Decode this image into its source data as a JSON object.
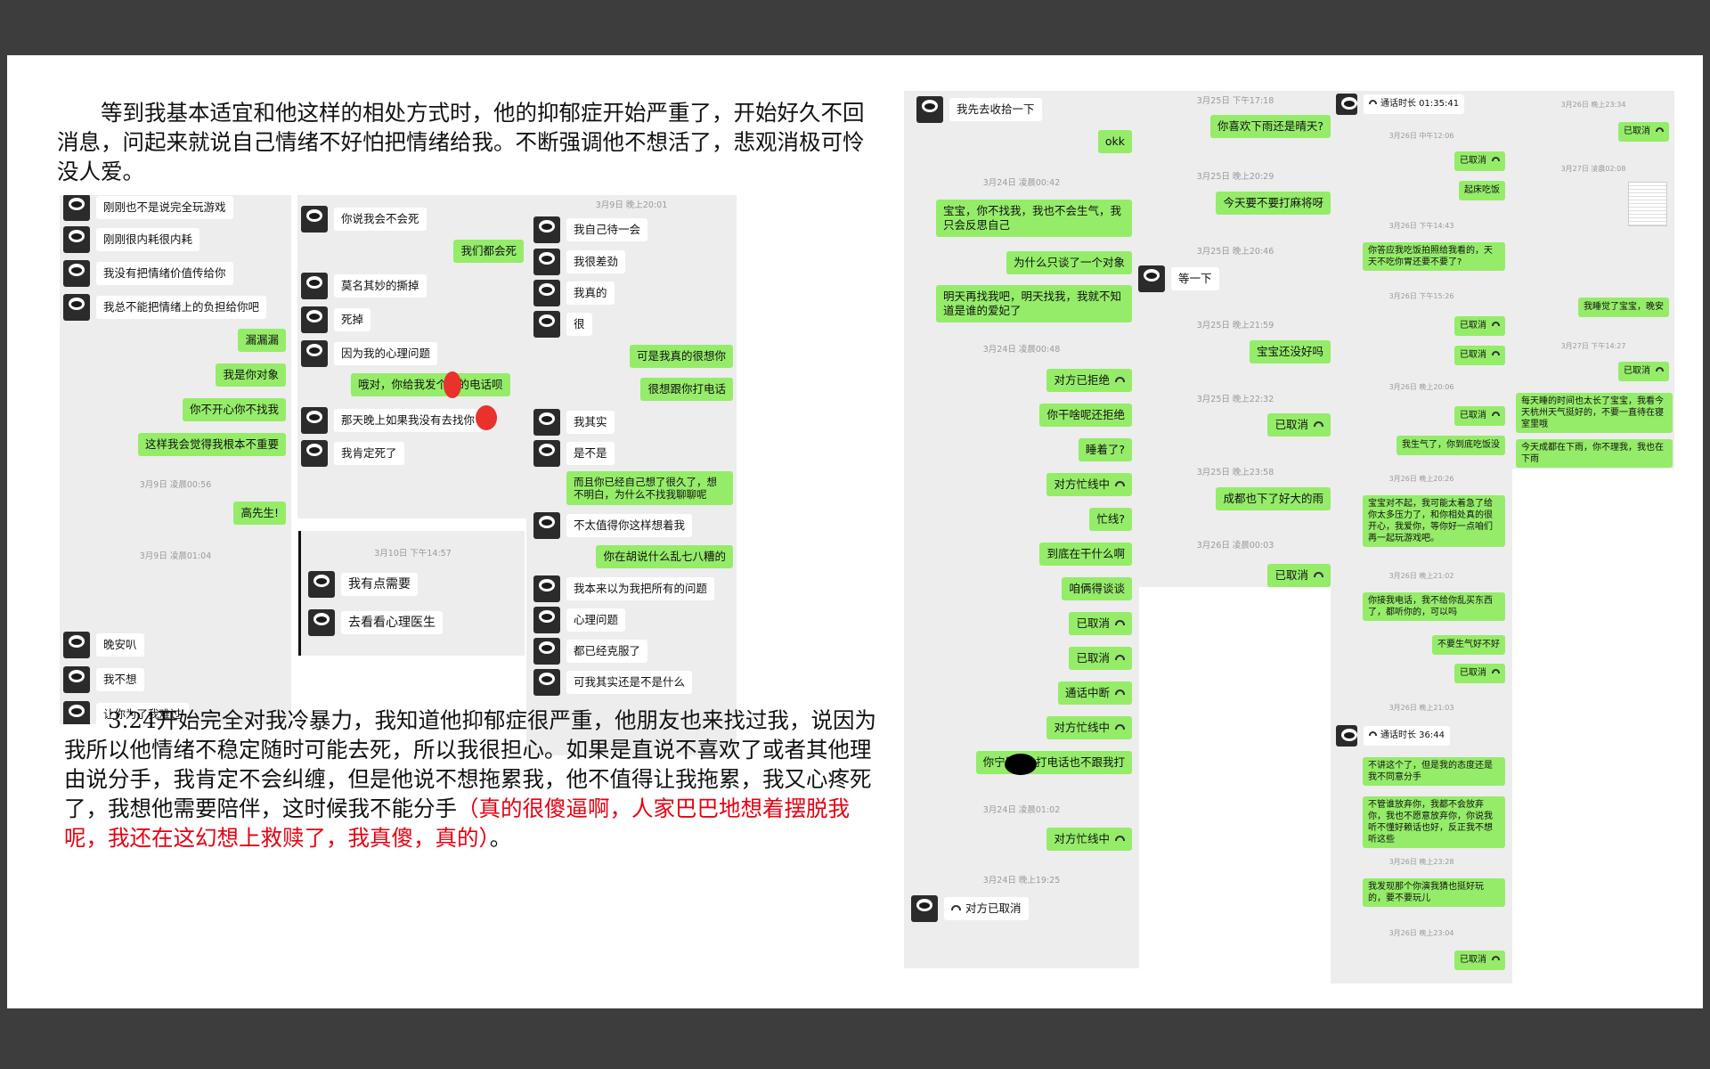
{
  "doc": {
    "para1": "　　等到我基本适宜和他这样的相处方式时，他的抑郁症开始严重了，开始好久不回消息，问起来就说自己情绪不好怕把情绪给我。不断强调他不想活了，悲观消极可怜没人爱。",
    "para2_black": "　　3.24开始完全对我冷暴力，我知道他抑郁症很严重，他朋友也来找过我，说因为我所以他情绪不稳定随时可能去死，所以我很担心。如果是直说不喜欢了或者其他理由说分手，我肯定不会纠缠，但是他说不想拖累我，他不值得让我拖累，我又心疼死了，我想他需要陪伴，这时候我不能分手",
    "para2_red": "（真的很傻逼啊，人家巴巴地想着摆脱我呢，我还在这幻想上救赎了，我真傻，真的）",
    "para2_end": "。"
  },
  "s1": {
    "m1": "刚刚也不是说完全玩游戏",
    "m2": "刚刚很内耗很内耗",
    "m3": "我没有把情绪价值传给你",
    "m4": "我总不能把情绪上的负担给你吧",
    "m5": "漏漏漏",
    "m6": "我是你对象",
    "m7": "你不开心你不找我",
    "m8": "这样我会觉得我根本不重要",
    "t1": "3月9日 凌晨00:56",
    "m9": "高先生!",
    "t2": "3月9日 凌晨01:04",
    "m10": "晚安叭",
    "m11": "我不想",
    "m12": "让你为了我难过"
  },
  "s2": {
    "m1": "你说我会不会死",
    "m2": "我们都会死",
    "m3": "莫名其妙的撕掉",
    "m4": "死掉",
    "m5": "因为我的心理问题",
    "m6": "哦对，你给我发个新的电话呗",
    "m7": "那天晚上如果我没有去找你",
    "m8": "我肯定死了"
  },
  "s3": {
    "t1": "3月10日 下午14:57",
    "m1": "我有点需要",
    "m2": "去看看心理医生"
  },
  "s4": {
    "t1": "3月9日 晚上20:01",
    "m1": "我自己待一会",
    "m2": "我很差劲",
    "m3": "我真的",
    "m4": "很",
    "m5": "可是我真的很想你",
    "m6": "很想跟你打电话",
    "m7": "我其实",
    "m8": "是不是",
    "m9": "而且你已经自己想了很久了，想不明白，为什么不找我聊聊呢",
    "m10": "不太值得你这样想着我",
    "m11": "你在胡说什么乱七八糟的",
    "m12": "我本来以为我把所有的问题",
    "m13": "心理问题",
    "m14": "都已经克服了",
    "m15": "可我其实还是不是什么"
  },
  "s5": {
    "m1": "我先去收拾一下",
    "m2": "okk",
    "t1": "3月24日 凌晨00:42",
    "m3": "宝宝，你不找我，我也不会生气，我只会反思自己",
    "m4": "为什么只谈了一个对象",
    "m5": "明天再找我吧，明天找我，我就不知道是谁的爱妃了",
    "t2": "3月24日 凌晨00:48",
    "m6": "对方已拒绝",
    "m7": "你干啥呢还拒绝",
    "m8": "睡着了?",
    "m9": "对方忙线中",
    "m10": "忙线?",
    "m11": "到底在干什么啊",
    "m12": "咱俩得谈谈",
    "m13": "已取消",
    "m14": "已取消",
    "m15": "通话中断",
    "m16": "对方忙线中",
    "m17": "你宁愿●●打电话也不跟我打",
    "t3": "3月24日 凌晨01:02",
    "m18": "对方忙线中",
    "t4": "3月24日 晚上19:25",
    "m19": "对方已取消"
  },
  "s6": {
    "t1": "3月25日 下午17:18",
    "m1": "你喜欢下雨还是晴天?",
    "t2": "3月25日 晚上20:29",
    "m2": "今天要不要打麻将呀",
    "t3": "3月25日 晚上20:46",
    "m3": "等一下",
    "t4": "3月25日 晚上21:59",
    "m4": "宝宝还没好吗",
    "t5": "3月25日 晚上22:32",
    "m5": "已取消",
    "t6": "3月25日 晚上23:58",
    "m6": "成都也下了好大的雨",
    "t7": "3月26日 凌晨00:03",
    "m7": "已取消"
  },
  "s7": {
    "m1": "通话时长 01:35:41",
    "t1": "3月26日 中午12:06",
    "m2": "已取消",
    "m3": "起床吃饭",
    "t2": "3月26日 下午14:43",
    "m4": "你答应我吃饭拍照给我看的，天天不吃你胃还要不要了?",
    "t3": "3月26日 下午15:26",
    "m5": "已取消",
    "m6": "已取消",
    "t4": "3月26日 晚上20:06",
    "m7": "已取消",
    "m8": "我生气了，你到底吃饭没",
    "t5": "3月26日 晚上20:26",
    "m9": "宝宝对不起，我可能太着急了给你太多压力了，和你相处真的很开心，我爱你，等你好一点咱们再一起玩游戏吧。",
    "t6": "3月26日 晚上21:02",
    "m10": "你接我电话，我不给你乱买东西了，都听你的，可以吗",
    "m11": "不要生气好不好",
    "m12": "已取消",
    "t7": "3月26日 晚上21:03",
    "m13": "通话时长 36:44",
    "m14": "不讲这个了，但是我的态度还是我不同意分手",
    "m15": "不管谁放弃你，我都不会放弃你，我也不愿意放弃你，你说我听不懂好赖话也好，反正我不想听这些",
    "t8": "3月26日 晚上23:28",
    "m16": "我发现那个你演我猜也挺好玩的，要不要玩儿",
    "t9": "3月26日 晚上23:04",
    "m17": "已取消"
  },
  "s8": {
    "t1": "3月26日 晚上23:34",
    "m1": "已取消",
    "t2": "3月27日 凌晨02:08",
    "m2": "我睡觉了宝宝，晚安",
    "t3": "3月27日 下午14:27",
    "m3": "已取消",
    "m4": "每天睡的时间也太长了宝宝，我看今天杭州天气挺好的，不要一直待在寝室里哦",
    "m5": "今天成都在下雨，你不理我，我也在下雨"
  }
}
